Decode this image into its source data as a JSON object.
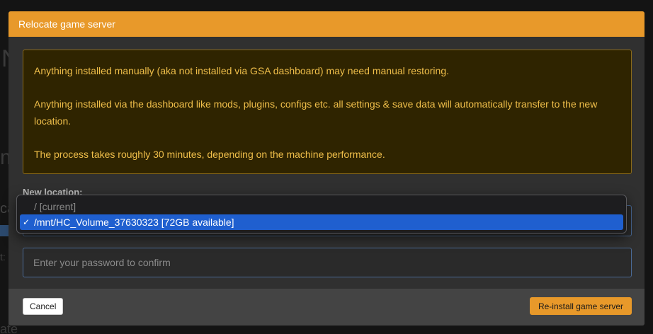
{
  "background": {
    "big_text": "N",
    "mid_text": "m",
    "small1": "ca",
    "small2": "t:",
    "bottom": "ate"
  },
  "modal": {
    "title": "Relocate game server",
    "alert": {
      "line1": "Anything installed manually (aka not installed via GSA dashboard) may need manual restoring.",
      "line2": "Anything installed via the dashboard like mods, plugins, configs etc. all settings & save data will automatically transfer to the new location.",
      "line3": "The process takes roughly 30 minutes, depending on the machine performance."
    },
    "location_label": "New location:",
    "location_select": {
      "options": [
        {
          "label": "/ [current]",
          "selected": false
        },
        {
          "label": "/mnt/HC_Volume_37630323 [72GB available]",
          "selected": true
        }
      ]
    },
    "password_placeholder": "Enter your password to confirm",
    "cancel_label": "Cancel",
    "reinstall_label": "Re-install game server",
    "check_glyph": "✓"
  },
  "colors": {
    "accent": "#e8992a",
    "alert_text": "#f0bf4a",
    "alert_bg": "#2f2400",
    "selected_option": "#1f5fcf"
  }
}
